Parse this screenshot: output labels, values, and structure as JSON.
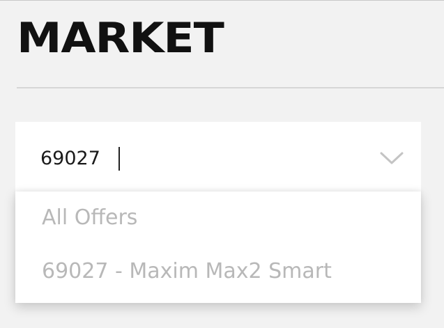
{
  "page": {
    "title": "MARKET"
  },
  "search": {
    "value": "69027",
    "chevron_icon": "chevron-down-icon"
  },
  "dropdown": {
    "options": [
      {
        "label": "All Offers"
      },
      {
        "label": "69027 - Maxim Max2 Smart"
      }
    ]
  },
  "colors": {
    "background": "#f2f2f2",
    "title": "#111111",
    "option_text": "#b8b8b8",
    "panel": "#ffffff"
  }
}
